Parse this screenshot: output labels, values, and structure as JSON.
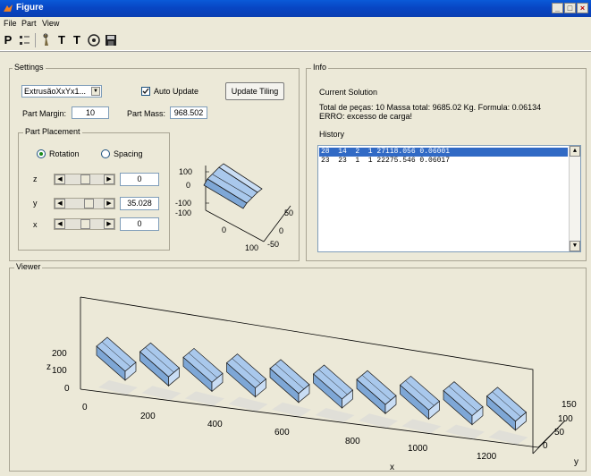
{
  "window": {
    "title": "Figure"
  },
  "menu": [
    "File",
    "Part",
    "View"
  ],
  "toolbar": {
    "p_label": "P",
    "t1_label": "T",
    "t2_label": "T"
  },
  "settings": {
    "title": "Settings",
    "profile_select": "ExtrusãoXxYx1...",
    "auto_update_label": "Auto Update",
    "auto_update_checked": true,
    "update_tiling_label": "Update Tiling",
    "part_margin_label": "Part Margin:",
    "part_margin_value": "10",
    "part_mass_label": "Part Mass:",
    "part_mass_value": "968.502",
    "placement": {
      "title": "Part Placement",
      "rotation_label": "Rotation",
      "spacing_label": "Spacing",
      "selected": "rotation",
      "z_label": "z",
      "z_value": "0",
      "y_label": "y",
      "y_value": "35.028",
      "x_label": "x",
      "x_value": "0"
    },
    "preview_axes": {
      "z_ticks": [
        "100",
        "0",
        "-100",
        "-100"
      ],
      "x_tick": "0",
      "x_tick2": "100",
      "y_ticks": [
        "50",
        "0",
        "-50"
      ]
    }
  },
  "info": {
    "title": "Info",
    "current_solution_label": "Current Solution",
    "summary": "Total de peças: 10 Massa total: 9685.02 Kg. Formula: 0.06134",
    "error": "ERRO: excesso de carga!",
    "history_label": "History",
    "history": [
      "28  14  2  1 27118.056 0.06001",
      "23  23  1  1 22275.546 0.06017"
    ]
  },
  "viewer": {
    "title": "Viewer",
    "z_ticks": [
      "200",
      "100",
      "0"
    ],
    "z_label": "z",
    "x_ticks": [
      "0",
      "200",
      "400",
      "600",
      "800",
      "1000",
      "1200"
    ],
    "x_label": "x",
    "y_ticks": [
      "150",
      "100",
      "50",
      "0"
    ],
    "y_label": "y",
    "part_count": 10
  },
  "colors": {
    "titlebar": "#0a46c4",
    "part_fill": "#a9c8ec",
    "selection": "#316ac5"
  }
}
